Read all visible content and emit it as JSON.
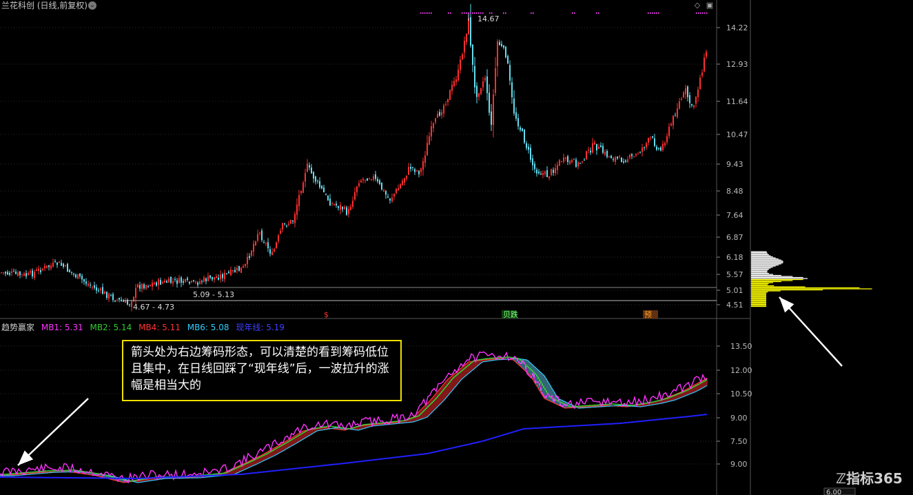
{
  "window": {
    "title": "兰花科创 (日线,前复权)"
  },
  "main_chart": {
    "price_axis_labels": [
      "14.22",
      "12.93",
      "11.64",
      "10.47",
      "9.43",
      "8.48",
      "7.64",
      "6.87",
      "6.18",
      "5.57",
      "5.01",
      "4.51"
    ],
    "high_label": "14.67",
    "low_label": "4.67 - 4.73",
    "range_label": "5.09 - 5.13",
    "signals": [
      {
        "text": "$",
        "color": "#ff3030"
      },
      {
        "text": "贝跌",
        "color": "#80ff80"
      },
      {
        "text": "预",
        "color": "#ffa020"
      }
    ]
  },
  "indicator": {
    "name": "趋势赢家",
    "values": [
      {
        "label": "MB1: 5.31",
        "color": "#ff33ff"
      },
      {
        "label": "MB2: 5.14",
        "color": "#33cc33"
      },
      {
        "label": "MB4: 5.11",
        "color": "#ff3333"
      },
      {
        "label": "MB6: 5.08",
        "color": "#33ccff"
      },
      {
        "label": "现年线: 5.19",
        "color": "#4040ff"
      }
    ],
    "axis_labels": [
      "13.50",
      "12.00",
      "10.50",
      "9.00",
      "7.50",
      "9.00"
    ]
  },
  "annotation": {
    "text": "箭头处为右边筹码形态，可以清楚的看到筹码低位且集中，在日线回踩了“现年线”后，一波拉升的涨幅是相当大的"
  },
  "bottom_axis": {
    "value": "6.00"
  },
  "watermark": {
    "text": "指标365"
  },
  "colors": {
    "up": "#ff3030",
    "down": "#66ddee",
    "chip_yellow": "#ffff00",
    "annotation_border": "#f0e000"
  }
}
